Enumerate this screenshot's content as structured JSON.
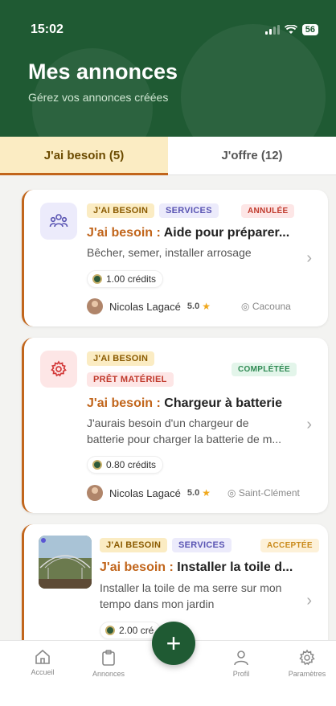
{
  "status": {
    "time": "15:02",
    "battery": "56"
  },
  "header": {
    "title": "Mes annonces",
    "subtitle": "Gérez vos annonces créées"
  },
  "tabs": [
    {
      "label": "J'ai besoin (5)",
      "active": true
    },
    {
      "label": "J'offre (12)",
      "active": false
    }
  ],
  "cards": [
    {
      "badges": [
        "J'AI BESOIN",
        "SERVICES"
      ],
      "status": "ANNULÉE",
      "title_prefix": "J'ai besoin :",
      "title": "Aide pour préparer...",
      "description": "Bêcher, semer, installer arrosage",
      "credits": "1.00 crédits",
      "user": "Nicolas Lagacé",
      "rating": "5.0",
      "location": "Cacouna",
      "icon": "people-icon"
    },
    {
      "badges": [
        "J'AI BESOIN",
        "PRÊT MATÉRIEL"
      ],
      "status": "COMPLÉTÉE",
      "title_prefix": "J'ai besoin :",
      "title": "Chargeur à batterie",
      "description_lines": [
        "J'aurais besoin d'un chargeur de",
        "batterie pour charger la batterie de m..."
      ],
      "credits": "0.80 crédits",
      "user": "Nicolas Lagacé",
      "rating": "5.0",
      "location": "Saint-Clément",
      "icon": "gear-icon"
    },
    {
      "badges": [
        "J'AI BESOIN",
        "SERVICES"
      ],
      "status": "ACCEPTÉE",
      "title_prefix": "J'ai besoin :",
      "title": "Installer la toile d...",
      "description_lines": [
        "Installer la toile de ma serre sur mon",
        "tempo dans mon jardin"
      ],
      "credits": "2.00 cré",
      "icon": "greenhouse-photo"
    }
  ],
  "nav": {
    "home": "Accueil",
    "ads": "Annonces",
    "profile": "Profil",
    "settings": "Paramètres",
    "fab": "+"
  },
  "colors": {
    "primary": "#1f5a33",
    "accent": "#c1651b"
  }
}
